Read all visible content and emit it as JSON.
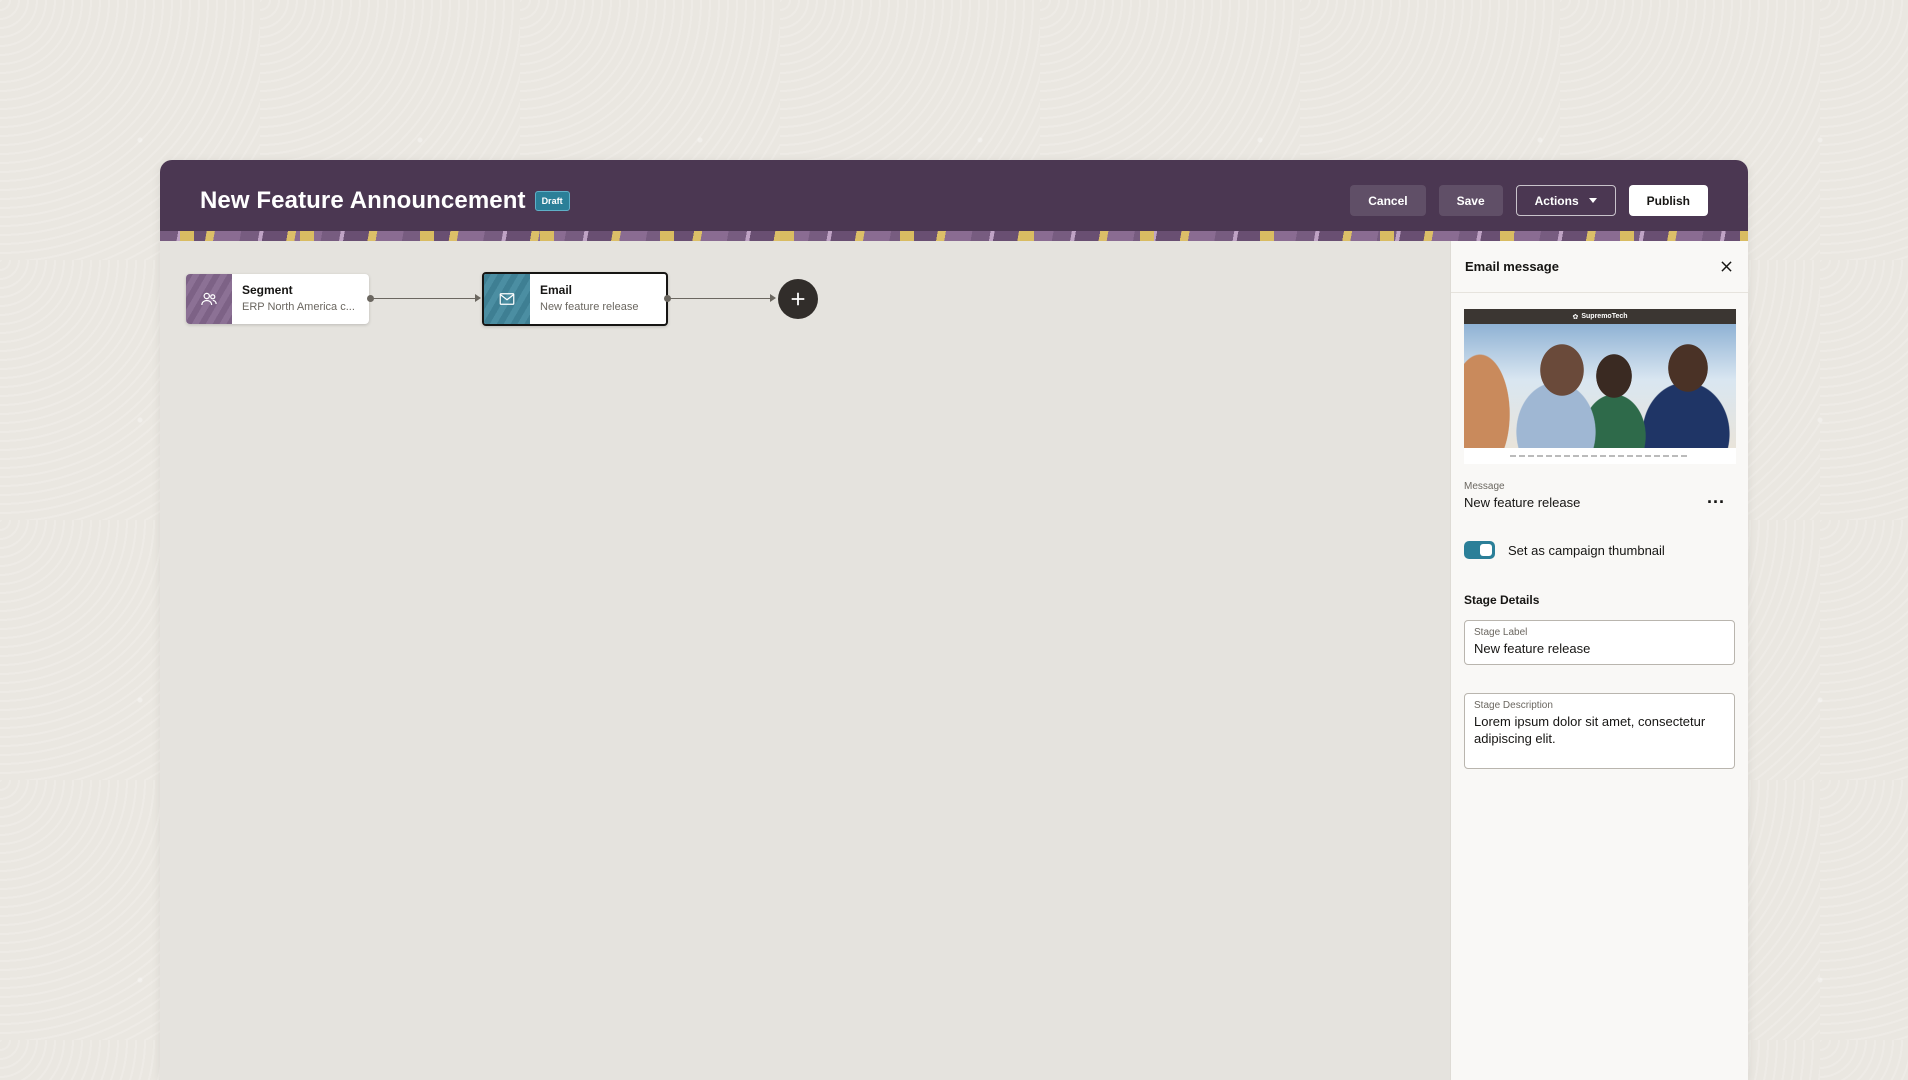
{
  "header": {
    "title": "New Feature Announcement",
    "badge": "Draft",
    "cancel_label": "Cancel",
    "save_label": "Save",
    "actions_label": "Actions",
    "publish_label": "Publish"
  },
  "flow": {
    "nodes": [
      {
        "label": "Segment",
        "sub": "ERP North America c...",
        "icon": "users-icon"
      },
      {
        "label": "Email",
        "sub": "New feature release",
        "icon": "envelope-icon"
      }
    ],
    "add_icon": "plus-icon"
  },
  "panel": {
    "title": "Email message",
    "preview_brand": "SupremoTech",
    "message_label": "Message",
    "message_value": "New feature release",
    "more_label": "...",
    "thumbnail_toggle_label": "Set as campaign thumbnail",
    "thumbnail_toggle_on": true,
    "stage_details_heading": "Stage Details",
    "stage_label_label": "Stage Label",
    "stage_label_value": "New feature release",
    "stage_description_label": "Stage Description",
    "stage_description_value": "Lorem ipsum dolor sit amet, consectetur adipiscing elit."
  },
  "colors": {
    "header_bg": "#4b3752",
    "accent": "#2b7f98",
    "segment_icon_bg": "#7d6286",
    "email_icon_bg": "#3e7f93"
  }
}
